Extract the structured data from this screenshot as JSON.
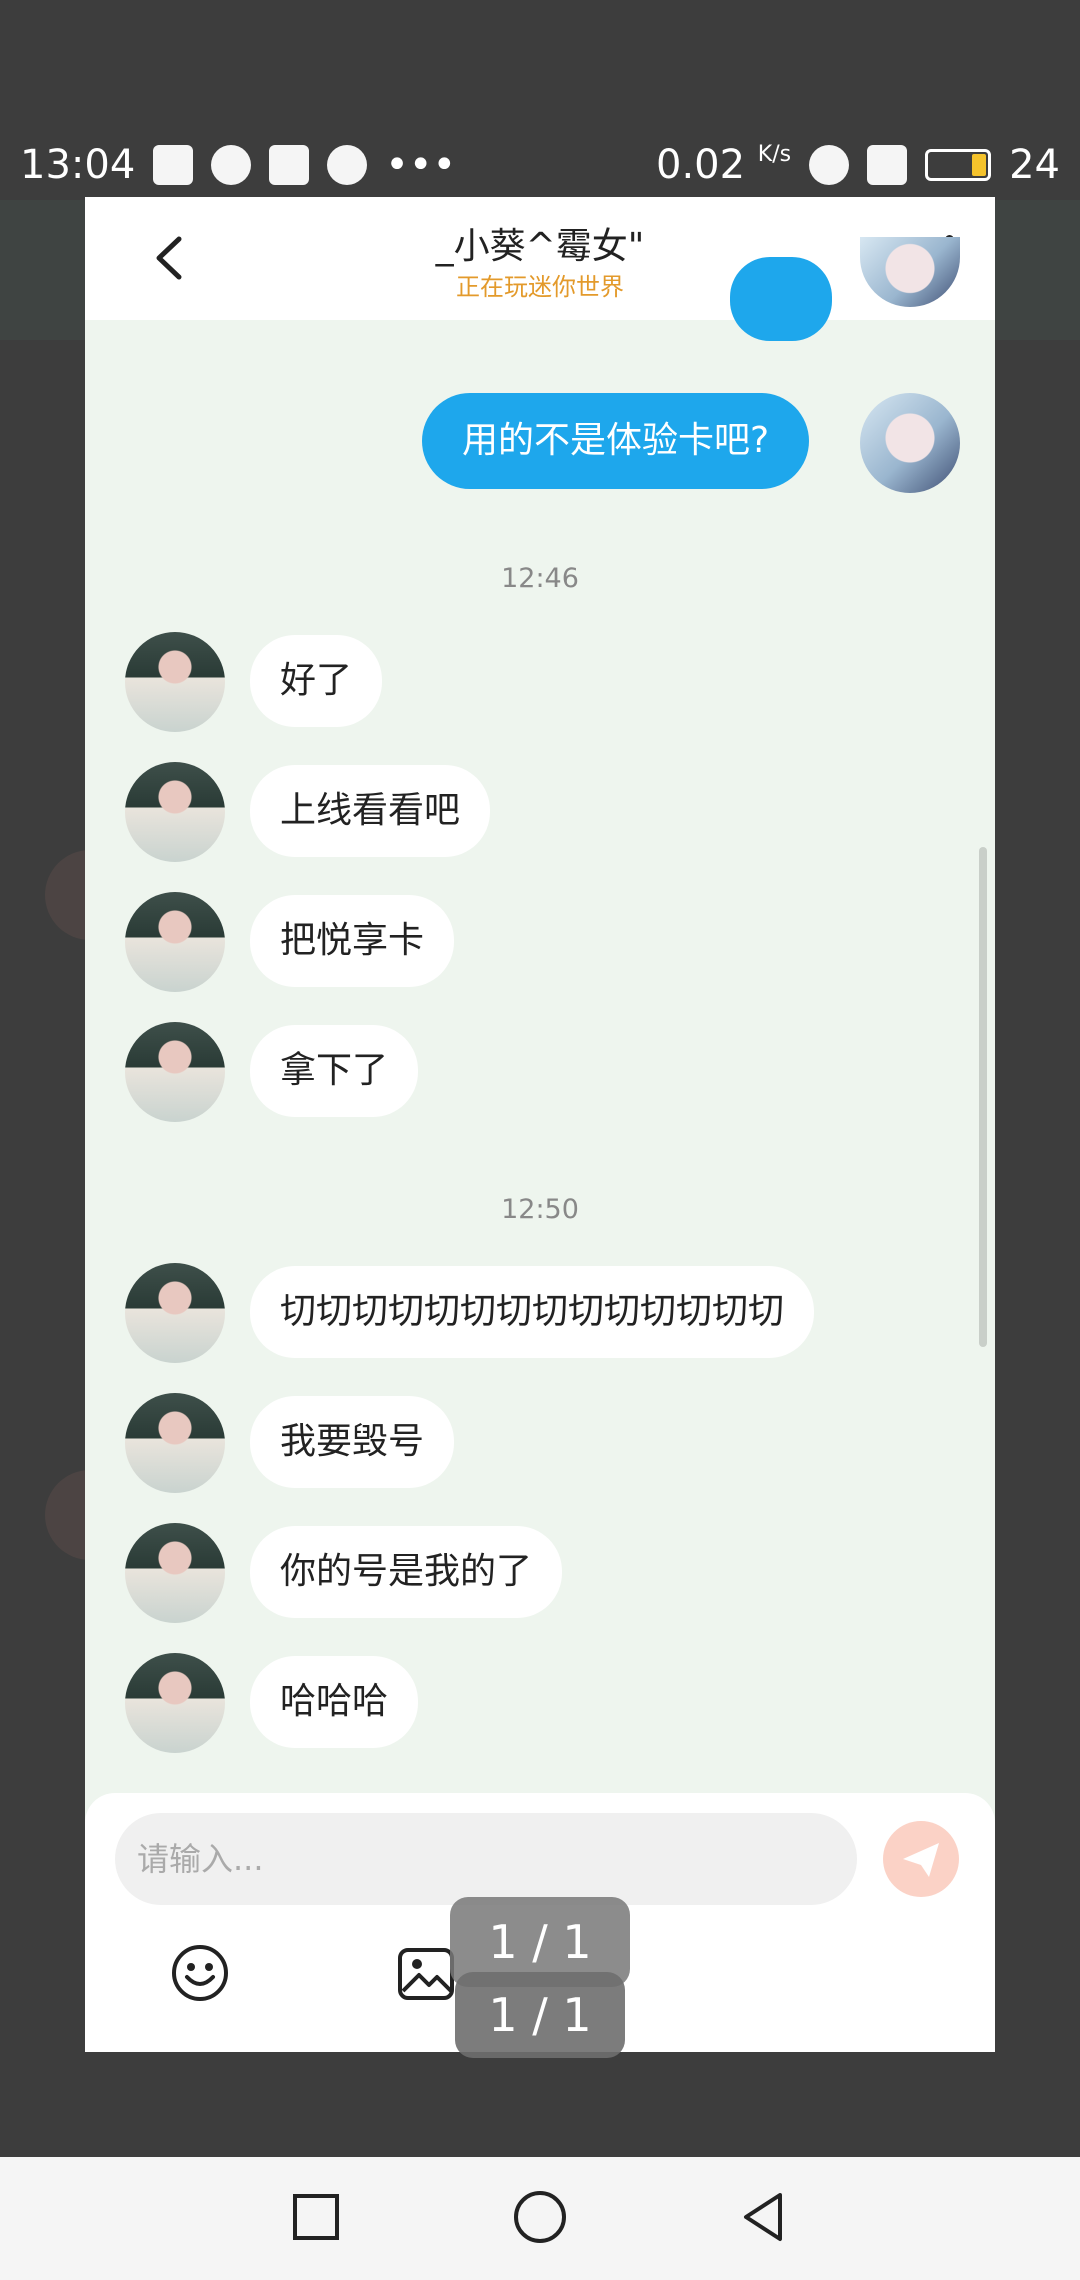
{
  "status_bar": {
    "time": "13:04",
    "net_speed": "0.02",
    "net_unit": "K/s",
    "battery": "24"
  },
  "chat": {
    "contact_name": "_小葵^霉女\"",
    "contact_status": "正在玩迷你世界",
    "messages_out": [
      {
        "text": "用的不是体验卡吧?"
      }
    ],
    "groups": [
      {
        "time": "12:46",
        "messages": [
          "好了",
          "上线看看吧",
          "把悦享卡",
          "拿下了"
        ]
      },
      {
        "time": "12:50",
        "messages": [
          "切切切切切切切切切切切切切切",
          "我要毁号",
          "你的号是我的了",
          "哈哈哈"
        ]
      }
    ],
    "input_placeholder": "请输入..."
  },
  "viewer": {
    "page_counter_primary": "1 / 1",
    "page_counter_secondary": "1 / 1"
  },
  "icons": [
    "back-icon",
    "more-icon",
    "send-icon",
    "emoji-icon",
    "image-icon",
    "square-icon",
    "circle-icon",
    "triangle-back-icon"
  ]
}
